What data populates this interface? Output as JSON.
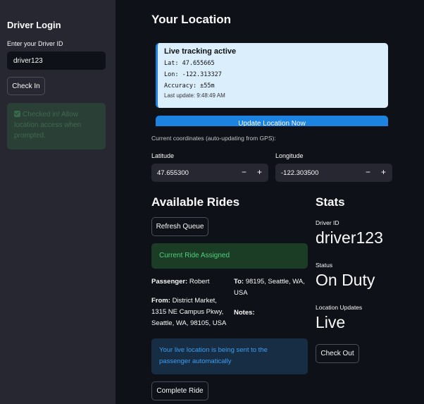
{
  "sidebar": {
    "title": "Driver Login",
    "driver_id_label": "Enter your Driver ID",
    "driver_id_value": "driver123",
    "check_in_label": "Check In",
    "success_message": "Checked in! Allow location access when prompted."
  },
  "location": {
    "title": "Your Location",
    "tracking": {
      "heading": "Live tracking active",
      "lat": "Lat: 47.655665",
      "lon": "Lon: -122.313327",
      "accuracy": "Accuracy: ±55m",
      "last_update": "Last update: 9:48:49 AM"
    },
    "update_button_label": "Update Location Now",
    "coords_note": "Current coordinates (auto-updating from GPS):",
    "latitude": {
      "label": "Latitude",
      "value": "47.655300",
      "minus": "−",
      "plus": "+"
    },
    "longitude": {
      "label": "Longitude",
      "value": "-122.303500",
      "minus": "−",
      "plus": "+"
    }
  },
  "rides": {
    "title": "Available Rides",
    "refresh_label": "Refresh Queue",
    "assigned_banner": "Current Ride Assigned",
    "passenger_label": "Passenger:",
    "passenger_value": "Robert",
    "to_label": "To:",
    "to_value": "98195, Seattle, WA, USA",
    "from_label": "From:",
    "from_value": "District Market, 1315 NE Campus Pkwy, Seattle, WA, 98105, USA",
    "notes_label": "Notes:",
    "info_message": "Your live location is being sent to the passenger automatically",
    "complete_label": "Complete Ride"
  },
  "stats": {
    "title": "Stats",
    "driver_id_label": "Driver ID",
    "driver_id_value": "driver123",
    "status_label": "Status",
    "status_value": "On Duty",
    "location_updates_label": "Location Updates",
    "location_updates_value": "Live",
    "checkout_label": "Check Out"
  },
  "colors": {
    "background": "#0e1117",
    "sidebar": "#262730",
    "primary": "#1c83e1",
    "success_text": "#4fd07c",
    "info_text": "#3d9df3"
  }
}
